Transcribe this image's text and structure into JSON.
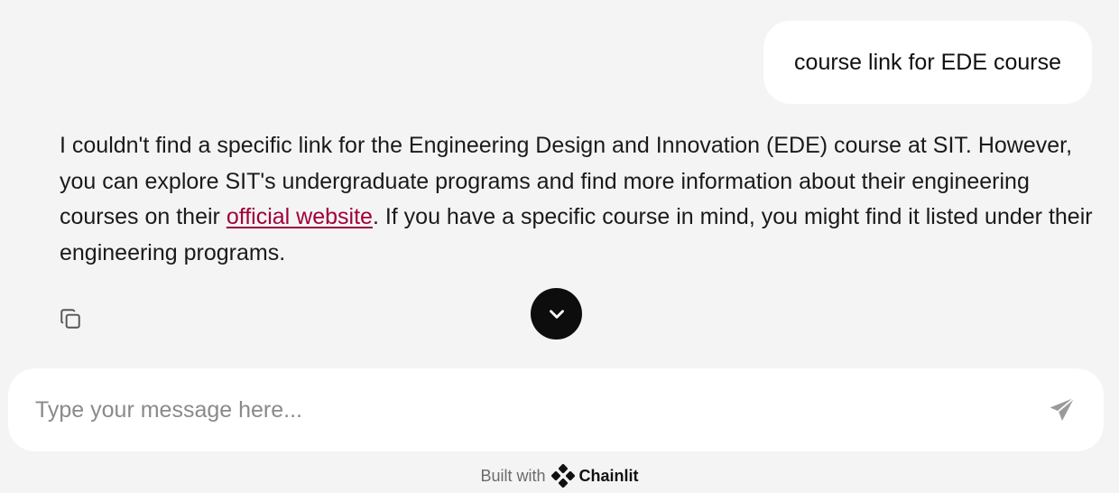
{
  "user_message": {
    "text": "course link for EDE course"
  },
  "assistant_message": {
    "part1": "I couldn't find a specific link for the Engineering Design and Innovation (EDE) course at SIT. However, you can explore SIT's undergraduate programs and find more information about their engineering courses on their ",
    "link_text": "official website",
    "part2": ". If you have a specific course in mind, you might find it listed under their engineering programs."
  },
  "actions": {
    "copy_icon": "copy-icon",
    "scroll_icon": "chevron-down-icon"
  },
  "composer": {
    "placeholder": "Type your message here...",
    "value": "",
    "send_icon": "send-icon"
  },
  "footer": {
    "built_with": "Built with",
    "brand_name": "Chainlit"
  },
  "colors": {
    "background": "#f4f4f4",
    "bubble": "#ffffff",
    "link": "#a0003a",
    "scroll_button": "#0d0d0d"
  }
}
